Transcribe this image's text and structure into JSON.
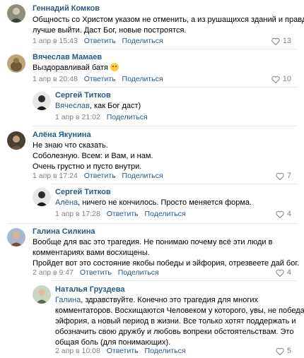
{
  "comments": [
    {
      "author": "Геннадий Комков",
      "lines": [
        "Общность со Христом указом не отменить, а из рушащихся зданий и правда",
        "лучше выйти. Даст Бог, новые построятся."
      ],
      "date": "1 апр в 15:43",
      "reply": "Ответить",
      "share": "Поделиться",
      "likes": "13"
    },
    {
      "author": "Вячеслав Мамаев",
      "lines": [
        "Выздоравливай батя"
      ],
      "date": "1 апр в 20:48",
      "reply": "Ответить",
      "share": "Поделиться",
      "likes": "10"
    },
    {
      "author": "Сергей Титков",
      "reply_to": "Вячеслав",
      "lines": [
        ", как Бог даст)"
      ],
      "date": "1 апр в 21:02",
      "share": "Поделиться"
    },
    {
      "author": "Алёна Якунина",
      "lines": [
        "Не знаю что сказать.",
        "Соболезную. Всем: и Вам, и нам.",
        "Очень грустно и пусто внутри."
      ],
      "date": "1 апр в 17:24",
      "reply": "Ответить",
      "share": "Поделиться",
      "likes": "7"
    },
    {
      "author": "Сергей Титков",
      "reply_to": "Алёна",
      "lines": [
        ", ничего не кончилось. Просто меняется форма."
      ],
      "date": "1 апр в 17:28",
      "reply": "Ответить",
      "share": "Поделиться",
      "likes": "4"
    },
    {
      "author": "Галина Силкина",
      "lines": [
        "Вообще для вас это трагедия. Не понимаю почему всё эти люди в",
        "комментариях вами восхищены.",
        "Пройдет вот это состояние якобы победы и эйфория, отрезвеете дай бог."
      ],
      "date": "2 апр в 9:47",
      "reply": "Ответить",
      "share": "Поделиться",
      "likes": "4"
    },
    {
      "author": "Наталья Груздева",
      "reply_to": "Галина",
      "lines": [
        ", здравствуйте. Конечно это трагедия для многих",
        "комментаторов. Восхищаются Человеком у которого, увы, не победа и",
        "эйфория, а новый период в жизни. Все только хотят поддержать и",
        "обозначить свою дружбу и любовь вопреки обстоятельствам. Это",
        "общая боль (для понимающих)."
      ],
      "date": "2 апр в 10:08",
      "reply": "Ответить",
      "share": "Поделиться",
      "likes": "5"
    }
  ],
  "colors": {
    "link": "#2a5885",
    "meta": "#828282",
    "divider": "#e7e8ec"
  }
}
